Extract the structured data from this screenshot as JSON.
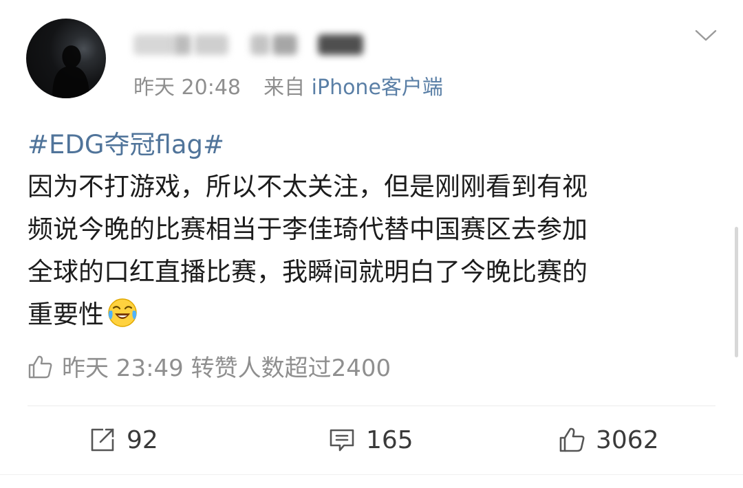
{
  "post": {
    "username": "",
    "timestamp": "昨天 20:48",
    "source_prefix": "来自",
    "source": "iPhone客户端",
    "topic": "#EDG夺冠flag#",
    "text_lines": [
      "因为不打游戏，所以不太关注，但是刚刚看到有视",
      "频说今晚的比赛相当于李佳琦代替中国赛区去参加",
      "全球的口红直播比赛，我瞬间就明白了今晚比赛的",
      "重要性"
    ],
    "emoji": "laugh-cry-emoji"
  },
  "like_note": {
    "text": "昨天 23:49 转赞人数超过2400",
    "icon": "thumbs-up-icon"
  },
  "actions": {
    "repost_count": "92",
    "comment_count": "165",
    "like_count": "3062"
  },
  "icons": {
    "repost": "repost-icon",
    "comment": "comment-icon",
    "like": "thumbs-up-icon",
    "menu": "chevron-down-icon"
  },
  "colors": {
    "topic": "#50749a",
    "source": "#5a7fa6",
    "meta": "#8f8f8f",
    "text": "#1c1c1c"
  }
}
